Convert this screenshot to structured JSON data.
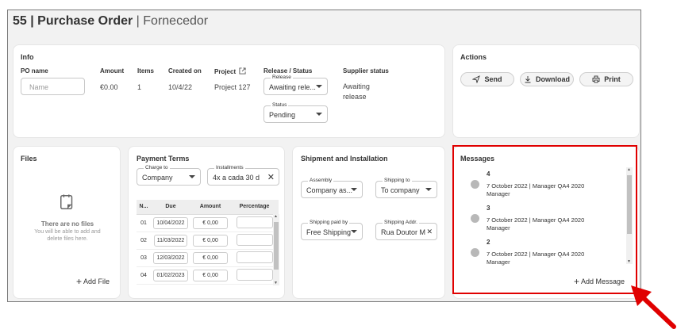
{
  "header": {
    "title_strong": "55 | Purchase Order",
    "title_light": "Fornecedor"
  },
  "info": {
    "title": "Info",
    "po_name": {
      "label": "PO name",
      "placeholder": "Name"
    },
    "amount": {
      "label": "Amount",
      "value": "€0.00"
    },
    "items": {
      "label": "Items",
      "value": "1"
    },
    "created_on": {
      "label": "Created on",
      "value": "10/4/22"
    },
    "project": {
      "label": "Project",
      "value": "Project 127"
    },
    "release_status": {
      "label": "Release / Status",
      "release": {
        "label": "Release",
        "value": "Awaiting rele..."
      },
      "status": {
        "label": "Status",
        "value": "Pending"
      }
    },
    "supplier_status": {
      "label": "Supplier status",
      "value_line1": "Awaiting",
      "value_line2": "release"
    }
  },
  "actions": {
    "title": "Actions",
    "send": "Send",
    "download": "Download",
    "print": "Print"
  },
  "files": {
    "title": "Files",
    "empty_title": "There are no files",
    "empty_line1": "You will be able to add and",
    "empty_line2": "delete files here.",
    "add_file": "Add File"
  },
  "payment": {
    "title": "Payment Terms",
    "charge_to": {
      "label": "Charge to",
      "value": "Company"
    },
    "installments": {
      "label": "Installments",
      "value": "4x a cada 30 d"
    },
    "columns": [
      "N...",
      "Due",
      "Amount",
      "Percentage"
    ],
    "rows": [
      {
        "n": "01",
        "due": "10/04/2022",
        "amount": "€ 0,00"
      },
      {
        "n": "02",
        "due": "11/03/2022",
        "amount": "€ 0,00"
      },
      {
        "n": "03",
        "due": "12/03/2022",
        "amount": "€ 0,00"
      },
      {
        "n": "04",
        "due": "01/02/2023",
        "amount": "€ 0,00"
      }
    ]
  },
  "shipment": {
    "title": "Shipment and Installation",
    "assembly": {
      "label": "Assembly",
      "value": "Company as..."
    },
    "shipping_to": {
      "label": "Shipping to",
      "value": "To company"
    },
    "shipping_paid_by": {
      "label": "Shipping paid by",
      "value": "Free Shipping"
    },
    "shipping_addr": {
      "label": "Shipping Addr.",
      "value": "Rua Doutor Mi"
    }
  },
  "messages": {
    "title": "Messages",
    "items": [
      {
        "num": "4",
        "line1": "7 October 2022 | Manager QA4 2020",
        "line2": "Manager"
      },
      {
        "num": "3",
        "line1": "7 October 2022 | Manager QA4 2020",
        "line2": "Manager"
      },
      {
        "num": "2",
        "line1": "7 October 2022 | Manager QA4 2020",
        "line2": "Manager"
      }
    ],
    "add_message": "Add Message"
  },
  "colors": {
    "highlight": "#e00000",
    "arrow": "#e00000"
  }
}
